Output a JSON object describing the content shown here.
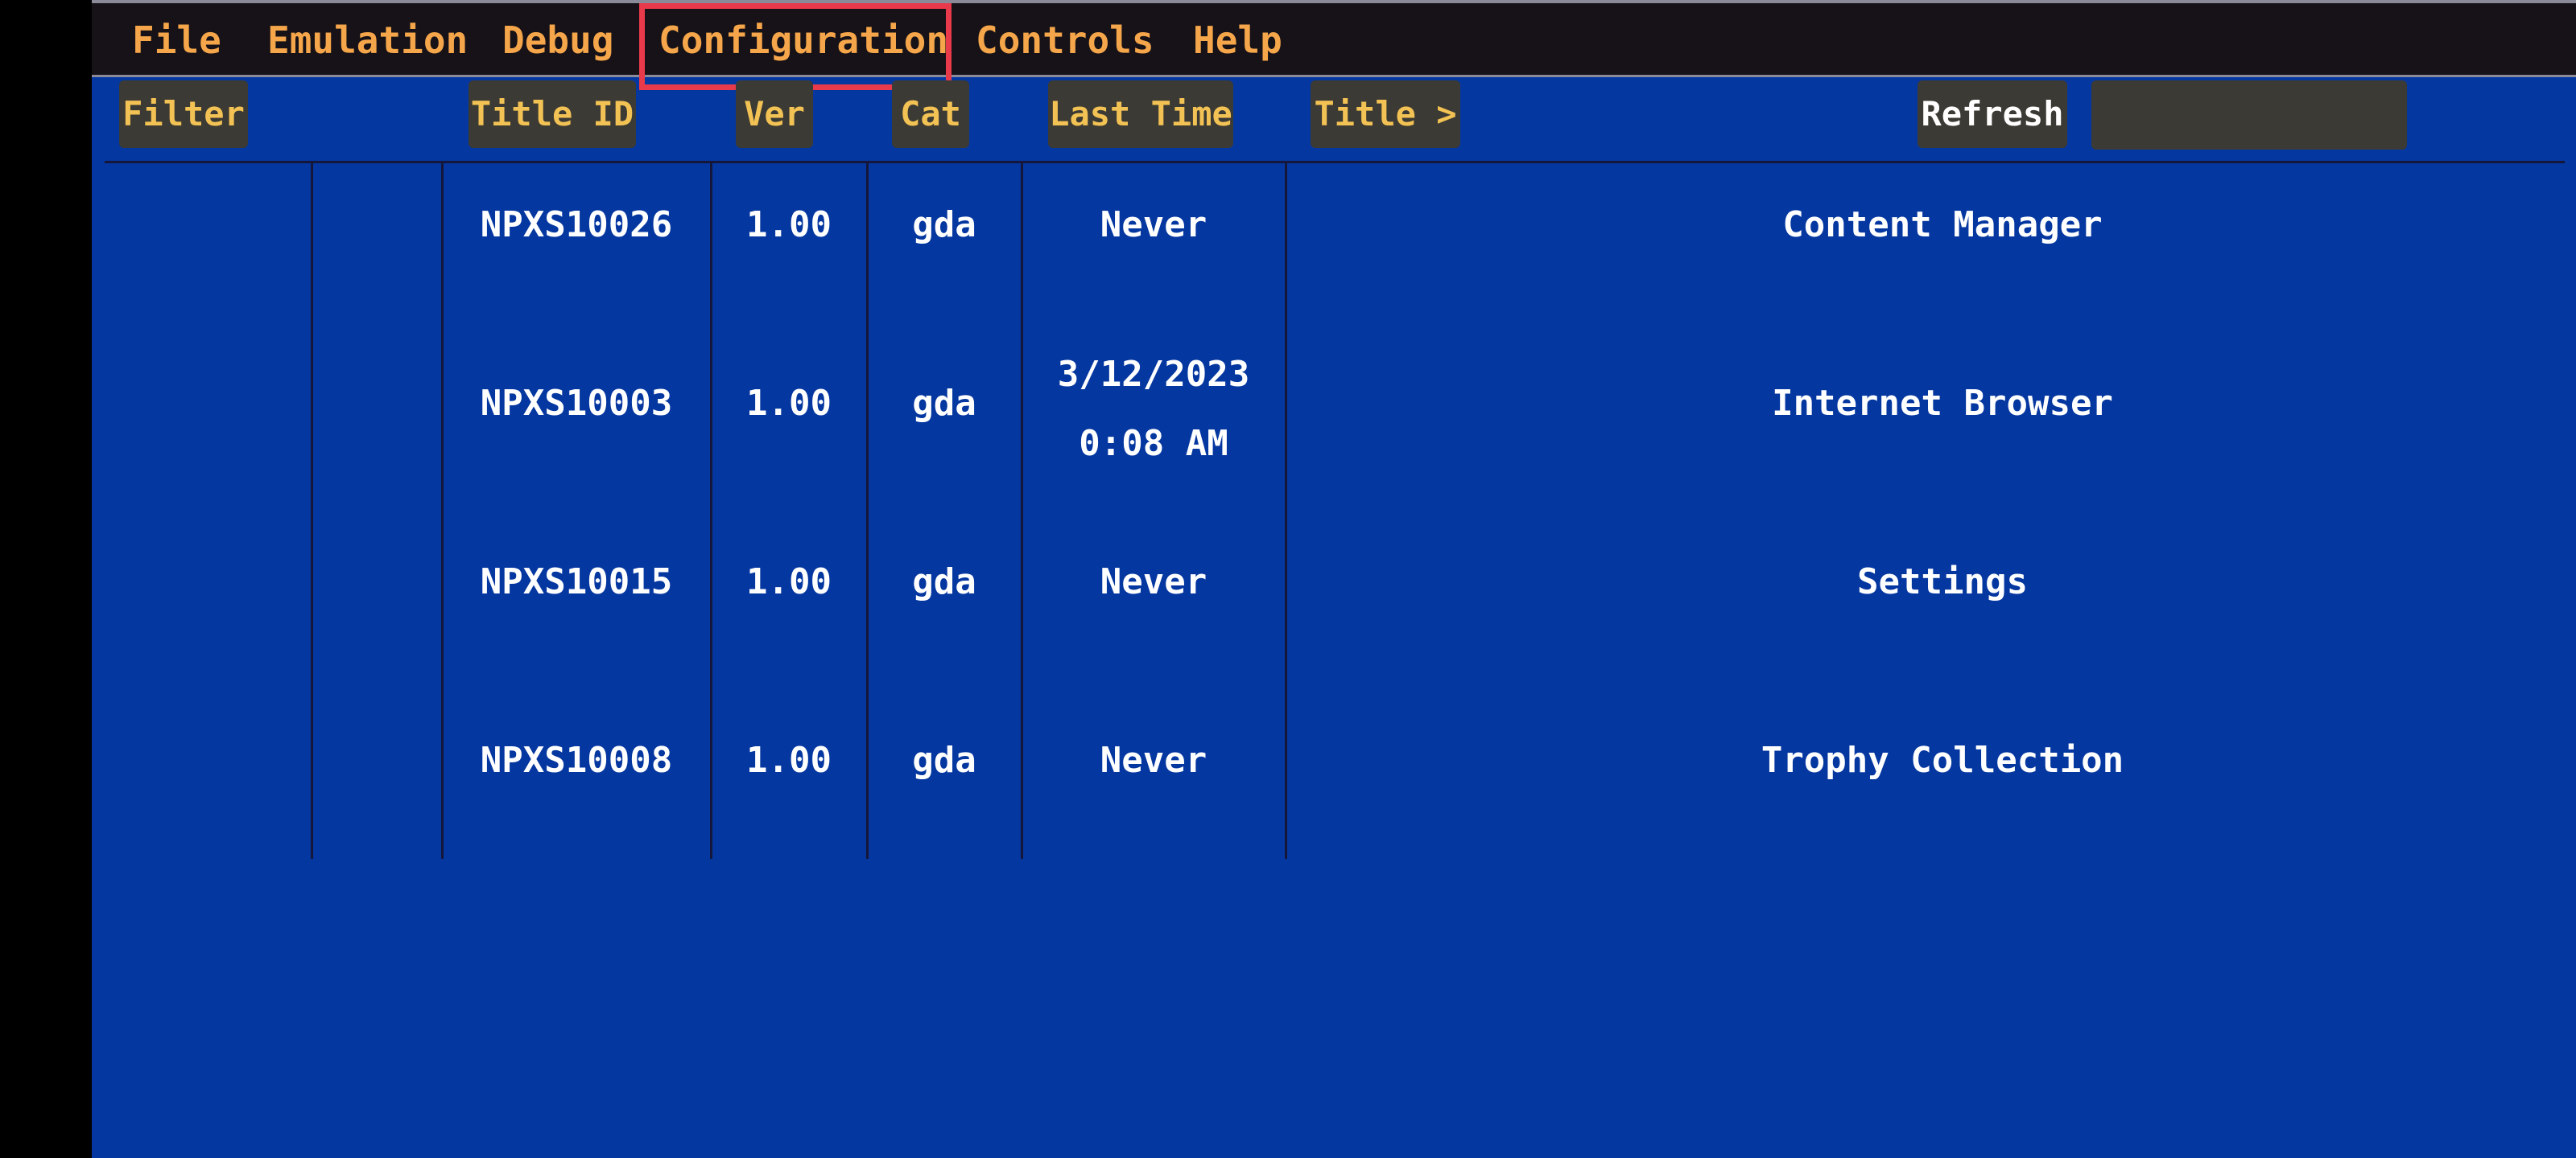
{
  "menu": {
    "items": [
      "File",
      "Emulation",
      "Debug",
      "Configuration",
      "Controls",
      "Help"
    ],
    "highlighted": "Configuration"
  },
  "toolbar": {
    "filter_label": "Filter",
    "refresh_label": "Refresh",
    "filter_value": ""
  },
  "columns": [
    "Title ID",
    "Ver",
    "Cat",
    "Last Time",
    "Title >"
  ],
  "apps": [
    {
      "title_id": "NPXS10026",
      "ver": "1.00",
      "cat": "gda",
      "last_time_line1": "Never",
      "last_time_line2": "",
      "title": "Content Manager"
    },
    {
      "title_id": "NPXS10003",
      "ver": "1.00",
      "cat": "gda",
      "last_time_line1": "3/12/2023",
      "last_time_line2": "0:08 AM",
      "title": "Internet Browser"
    },
    {
      "title_id": "NPXS10015",
      "ver": "1.00",
      "cat": "gda",
      "last_time_line1": "Never",
      "last_time_line2": "",
      "title": "Settings"
    },
    {
      "title_id": "NPXS10008",
      "ver": "1.00",
      "cat": "gda",
      "last_time_line1": "Never",
      "last_time_line2": "",
      "title": "Trophy Collection"
    }
  ],
  "colors": {
    "background": "#0537a0",
    "menubar": "#161217",
    "menu_text": "#f5a54a",
    "header_text": "#f3c254",
    "highlight": "#e83a4a"
  }
}
